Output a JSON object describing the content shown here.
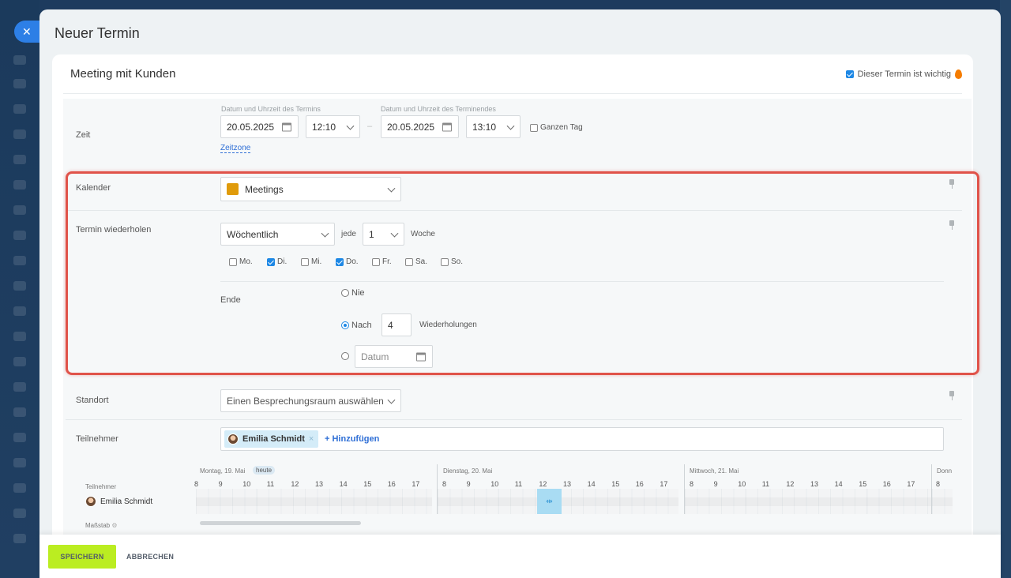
{
  "slider": {
    "title": "Neuer Termin",
    "close_icon": "close-icon"
  },
  "event": {
    "name": "Meeting mit Kunden",
    "important_label": "Dieser Termin ist wichtig",
    "important_checked": true
  },
  "time": {
    "label": "Zeit",
    "start_caption": "Datum und Uhrzeit des Termins",
    "end_caption": "Datum und Uhrzeit des Terminendes",
    "start_date": "20.05.2025",
    "start_time": "12:10",
    "dash": "–",
    "end_date": "20.05.2025",
    "end_time": "13:10",
    "all_day": "Ganzen Tag",
    "timezone": "Zeitzone"
  },
  "calendar": {
    "label": "Kalender",
    "value": "Meetings",
    "color": "#e09b0b"
  },
  "repeat": {
    "label": "Termin wiederholen",
    "frequency": "Wöchentlich",
    "every": "jede",
    "interval": "1",
    "unit": "Woche",
    "days": [
      {
        "label": "Mo.",
        "checked": false
      },
      {
        "label": "Di.",
        "checked": true
      },
      {
        "label": "Mi.",
        "checked": false
      },
      {
        "label": "Do.",
        "checked": true
      },
      {
        "label": "Fr.",
        "checked": false
      },
      {
        "label": "Sa.",
        "checked": false
      },
      {
        "label": "So.",
        "checked": false
      }
    ],
    "end_label": "Ende",
    "never": "Nie",
    "after": "Nach",
    "count": "4",
    "repetitions": "Wiederholungen",
    "date_placeholder": "Datum"
  },
  "location": {
    "label": "Standort",
    "value": "Einen Besprechungsraum auswählen"
  },
  "participants": {
    "label": "Teilnehmer",
    "person": "Emilia Schmidt",
    "remove": "×",
    "add": "+ Hinzufügen"
  },
  "planner": {
    "days": [
      {
        "label": "Montag, 19. Mai",
        "badge": "heute"
      },
      {
        "label": "Dienstag, 20. Mai"
      },
      {
        "label": "Mittwoch, 21. Mai"
      },
      {
        "label": "Donn"
      }
    ],
    "hours_a": [
      "8",
      "9",
      "10",
      "11",
      "12",
      "13",
      "14",
      "15",
      "16",
      "17"
    ],
    "hours_b": [
      "8",
      "9",
      "10",
      "11",
      "12",
      "13",
      "14",
      "15",
      "16",
      "17"
    ],
    "hours_c": [
      "8",
      "9",
      "10",
      "11",
      "12",
      "13",
      "14",
      "15",
      "16",
      "17"
    ],
    "hours_d": [
      "8"
    ],
    "participants_caption": "Teilnehmer",
    "person": "Emilia Schmidt",
    "scale": "Maßstab"
  },
  "footer": {
    "save": "SPEICHERN",
    "cancel": "ABBRECHEN"
  }
}
